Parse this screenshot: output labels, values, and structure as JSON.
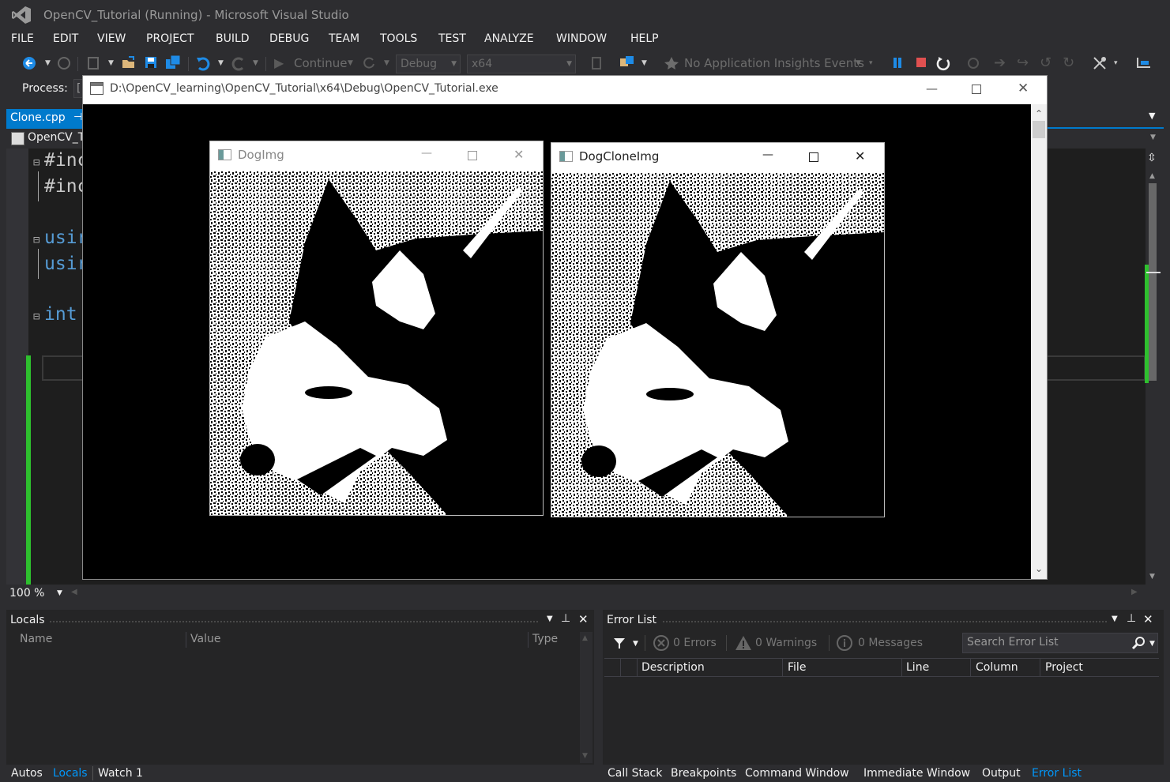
{
  "window": {
    "title": "OpenCV_Tutorial (Running) - Microsoft Visual Studio"
  },
  "menu": [
    "FILE",
    "EDIT",
    "VIEW",
    "PROJECT",
    "BUILD",
    "DEBUG",
    "TEAM",
    "TOOLS",
    "TEST",
    "ANALYZE",
    "WINDOW",
    "HELP"
  ],
  "toolbar": {
    "continue_label": "Continue",
    "config": "Debug",
    "platform": "x64",
    "insights": "No Application Insights Events"
  },
  "process": {
    "label": "Process:",
    "value": "["
  },
  "document": {
    "tab": "Clone.cpp",
    "nav_project": "OpenCV_T"
  },
  "code_lines": [
    {
      "text": "#inc",
      "color": "#c8c8c8",
      "fold": "⊟"
    },
    {
      "text": "#inc",
      "color": "#c8c8c8",
      "fold": ""
    },
    {
      "text": "usir",
      "color": "#569cd6",
      "fold": "⊟"
    },
    {
      "text": "usir",
      "color": "#569cd6",
      "fold": ""
    },
    {
      "text": "int",
      "color": "#569cd6",
      "fold": "⊟"
    }
  ],
  "zoom": "100 %",
  "locals": {
    "title": "Locals",
    "columns": [
      "Name",
      "Value",
      "Type"
    ],
    "tabs": [
      "Autos",
      "Locals",
      "Watch 1"
    ],
    "active_tab": "Locals"
  },
  "error_list": {
    "title": "Error List",
    "errors": "0 Errors",
    "warnings": "0 Warnings",
    "messages": "0 Messages",
    "search_placeholder": "Search Error List",
    "columns": [
      "Description",
      "File",
      "Line",
      "Column",
      "Project"
    ],
    "tabs": [
      "Call Stack",
      "Breakpoints",
      "Command Window",
      "Immediate Window",
      "Output",
      "Error List"
    ],
    "active_tab": "Error List"
  },
  "console": {
    "title": "D:\\OpenCV_learning\\OpenCV_Tutorial\\x64\\Debug\\OpenCV_Tutorial.exe"
  },
  "image_windows": [
    {
      "title": "DogImg",
      "active": false
    },
    {
      "title": "DogCloneImg",
      "active": true
    }
  ],
  "colors": {
    "accent": "#007acc",
    "background": "#2d2d30",
    "editor": "#1e1e1e",
    "change_bar": "#2ec02e"
  }
}
